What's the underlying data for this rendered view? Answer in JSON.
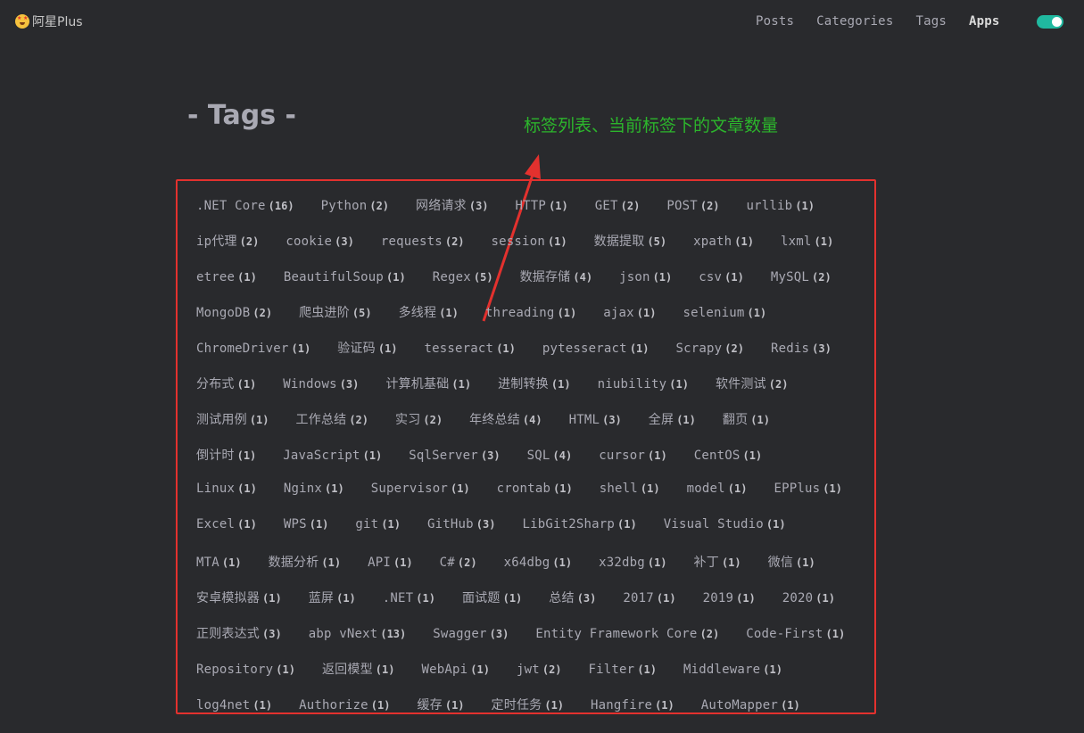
{
  "header": {
    "brand": "阿星Plus",
    "brand_icon": "star-struck-emoji-icon",
    "nav": [
      "Posts",
      "Categories",
      "Tags",
      "Apps"
    ],
    "active_nav": "Apps",
    "theme_toggle_on": true,
    "accent_color": "#20b9a0"
  },
  "main": {
    "title": "- Tags -",
    "annotation": "标签列表、当前标签下的文章数量",
    "annotation_color": "#2cb52c",
    "highlight_color": "#e3312e"
  },
  "tag_rows": [
    [
      {
        "name": ".NET Core",
        "count": "(16)"
      },
      {
        "name": "Python",
        "count": "(2)"
      },
      {
        "name": "网络请求",
        "count": "(3)"
      },
      {
        "name": "HTTP",
        "count": "(1)"
      },
      {
        "name": "GET",
        "count": "(2)"
      },
      {
        "name": "POST",
        "count": "(2)"
      },
      {
        "name": "urllib",
        "count": "(1)"
      }
    ],
    [
      {
        "name": "ip代理",
        "count": "(2)"
      },
      {
        "name": "cookie",
        "count": "(3)"
      },
      {
        "name": "requests",
        "count": "(2)"
      },
      {
        "name": "session",
        "count": "(1)"
      },
      {
        "name": "数据提取",
        "count": "(5)"
      },
      {
        "name": "xpath",
        "count": "(1)"
      },
      {
        "name": "lxml",
        "count": "(1)"
      }
    ],
    [
      {
        "name": "etree",
        "count": "(1)"
      },
      {
        "name": "BeautifulSoup",
        "count": "(1)"
      },
      {
        "name": "Regex",
        "count": "(5)"
      },
      {
        "name": "数据存储",
        "count": "(4)"
      },
      {
        "name": "json",
        "count": "(1)"
      },
      {
        "name": "csv",
        "count": "(1)"
      },
      {
        "name": "MySQL",
        "count": "(2)"
      }
    ],
    [
      {
        "name": "MongoDB",
        "count": "(2)"
      },
      {
        "name": "爬虫进阶",
        "count": "(5)"
      },
      {
        "name": "多线程",
        "count": "(1)"
      },
      {
        "name": "threading",
        "count": "(1)"
      },
      {
        "name": "ajax",
        "count": "(1)"
      },
      {
        "name": "selenium",
        "count": "(1)"
      }
    ],
    [
      {
        "name": "ChromeDriver",
        "count": "(1)"
      },
      {
        "name": "验证码",
        "count": "(1)"
      },
      {
        "name": "tesseract",
        "count": "(1)"
      },
      {
        "name": "pytesseract",
        "count": "(1)"
      },
      {
        "name": "Scrapy",
        "count": "(2)"
      },
      {
        "name": "Redis",
        "count": "(3)"
      }
    ],
    [
      {
        "name": "分布式",
        "count": "(1)"
      },
      {
        "name": "Windows",
        "count": "(3)"
      },
      {
        "name": "计算机基础",
        "count": "(1)"
      },
      {
        "name": "进制转换",
        "count": "(1)"
      },
      {
        "name": "niubility",
        "count": "(1)"
      },
      {
        "name": "软件测试",
        "count": "(2)"
      }
    ],
    [
      {
        "name": "测试用例",
        "count": "(1)"
      },
      {
        "name": "工作总结",
        "count": "(2)"
      },
      {
        "name": "实习",
        "count": "(2)"
      },
      {
        "name": "年终总结",
        "count": "(4)"
      },
      {
        "name": "HTML",
        "count": "(3)"
      },
      {
        "name": "全屏",
        "count": "(1)"
      },
      {
        "name": "翻页",
        "count": "(1)"
      }
    ],
    [
      {
        "name": "倒计时",
        "count": "(1)"
      },
      {
        "name": "JavaScript",
        "count": "(1)"
      },
      {
        "name": "SqlServer",
        "count": "(3)"
      },
      {
        "name": "SQL",
        "count": "(4)"
      },
      {
        "name": "cursor",
        "count": "(1)"
      },
      {
        "name": "CentOS",
        "count": "(1)"
      }
    ],
    [
      {
        "name": "Linux",
        "count": "(1)"
      },
      {
        "name": "Nginx",
        "count": "(1)"
      },
      {
        "name": "Supervisor",
        "count": "(1)"
      },
      {
        "name": "crontab",
        "count": "(1)"
      },
      {
        "name": "shell",
        "count": "(1)"
      },
      {
        "name": "model",
        "count": "(1)"
      },
      {
        "name": "EPPlus",
        "count": "(1)"
      }
    ],
    [
      {
        "name": "Excel",
        "count": "(1)"
      },
      {
        "name": "WPS",
        "count": "(1)"
      },
      {
        "name": "git",
        "count": "(1)"
      },
      {
        "name": "GitHub",
        "count": "(3)"
      },
      {
        "name": "LibGit2Sharp",
        "count": "(1)"
      },
      {
        "name": "Visual Studio",
        "count": "(1)"
      }
    ],
    [
      {
        "name": "MTA",
        "count": "(1)"
      },
      {
        "name": "数据分析",
        "count": "(1)"
      },
      {
        "name": "API",
        "count": "(1)"
      },
      {
        "name": "C#",
        "count": "(2)"
      },
      {
        "name": "x64dbg",
        "count": "(1)"
      },
      {
        "name": "x32dbg",
        "count": "(1)"
      },
      {
        "name": "补丁",
        "count": "(1)"
      },
      {
        "name": "微信",
        "count": "(1)"
      }
    ],
    [
      {
        "name": "安卓模拟器",
        "count": "(1)"
      },
      {
        "name": "蓝屏",
        "count": "(1)"
      },
      {
        "name": ".NET",
        "count": "(1)"
      },
      {
        "name": "面试题",
        "count": "(1)"
      },
      {
        "name": "总结",
        "count": "(3)"
      },
      {
        "name": "2017",
        "count": "(1)"
      },
      {
        "name": "2019",
        "count": "(1)"
      },
      {
        "name": "2020",
        "count": "(1)"
      }
    ],
    [
      {
        "name": "正则表达式",
        "count": "(3)"
      },
      {
        "name": "abp vNext",
        "count": "(13)"
      },
      {
        "name": "Swagger",
        "count": "(3)"
      },
      {
        "name": "Entity Framework Core",
        "count": "(2)"
      },
      {
        "name": "Code-First",
        "count": "(1)"
      }
    ],
    [
      {
        "name": "Repository",
        "count": "(1)"
      },
      {
        "name": "返回模型",
        "count": "(1)"
      },
      {
        "name": "WebApi",
        "count": "(1)"
      },
      {
        "name": "jwt",
        "count": "(2)"
      },
      {
        "name": "Filter",
        "count": "(1)"
      },
      {
        "name": "Middleware",
        "count": "(1)"
      }
    ],
    [
      {
        "name": "log4net",
        "count": "(1)"
      },
      {
        "name": "Authorize",
        "count": "(1)"
      },
      {
        "name": "缓存",
        "count": "(1)"
      },
      {
        "name": "定时任务",
        "count": "(1)"
      },
      {
        "name": "Hangfire",
        "count": "(1)"
      },
      {
        "name": "AutoMapper",
        "count": "(1)"
      }
    ]
  ]
}
